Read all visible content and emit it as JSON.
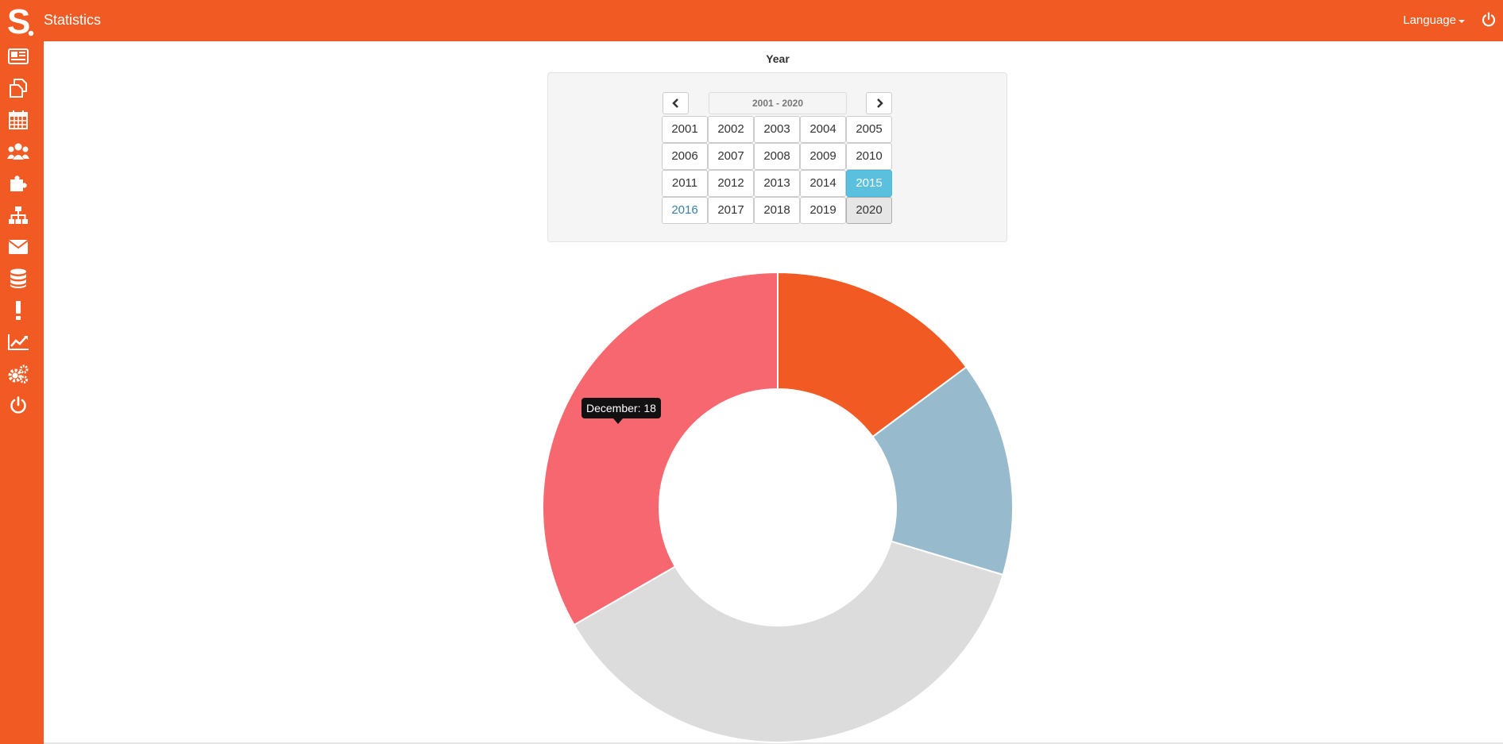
{
  "header": {
    "title": "Statistics",
    "language_label": "Language",
    "brand_color": "#f15a22"
  },
  "sidebar": {
    "items": [
      {
        "icon": "newspaper-icon"
      },
      {
        "icon": "copy-icon"
      },
      {
        "icon": "calendar-icon"
      },
      {
        "icon": "users-icon"
      },
      {
        "icon": "puzzle-icon"
      },
      {
        "icon": "sitemap-icon"
      },
      {
        "icon": "envelope-icon"
      },
      {
        "icon": "database-icon"
      },
      {
        "icon": "exclamation-icon"
      },
      {
        "icon": "line-chart-icon"
      },
      {
        "icon": "cogs-icon"
      },
      {
        "icon": "power-icon"
      }
    ]
  },
  "year_picker": {
    "label": "Year",
    "range_label": "2001 - 2020",
    "selected_year": "2015",
    "current_year": "2020",
    "years": [
      "2001",
      "2002",
      "2003",
      "2004",
      "2005",
      "2006",
      "2007",
      "2008",
      "2009",
      "2010",
      "2011",
      "2012",
      "2013",
      "2014",
      "2015",
      "2016",
      "2017",
      "2018",
      "2019",
      "2020"
    ]
  },
  "tooltip": {
    "text": "December: 18"
  },
  "chart_data": {
    "type": "pie",
    "donut": true,
    "categories": [
      "",
      "",
      "",
      "December"
    ],
    "values": [
      8,
      8,
      20,
      18
    ],
    "colors": [
      "#f15a22",
      "#97bbcd",
      "#dcdcdc",
      "#f7676f"
    ],
    "title": "",
    "legend": "none"
  }
}
